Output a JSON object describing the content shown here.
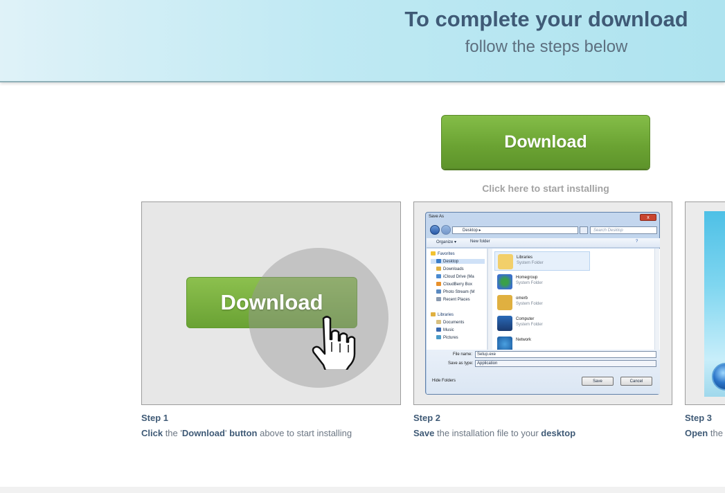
{
  "header": {
    "title": "To complete your download",
    "subtitle": "follow the steps below"
  },
  "download": {
    "button_label": "Download",
    "hint": "Click here to start installing"
  },
  "steps": [
    {
      "title": "Step 1",
      "illustration_label": "Download",
      "text": {
        "b1": "Click",
        "t1": " the '",
        "b2": "Download",
        "t2": "' ",
        "b3": "button",
        "t3": " above to start installing"
      }
    },
    {
      "title": "Step 2",
      "text": {
        "b1": "Save",
        "t1": " the installation file to your ",
        "b2": "desktop"
      }
    },
    {
      "title": "Step 3",
      "text": {
        "b1": "Open",
        "t1": " the"
      }
    }
  ],
  "dialog": {
    "title": "Save As",
    "close": "x",
    "address": "Desktop  ▸",
    "search_placeholder": "Search Desktop",
    "toolbar": {
      "organize": "Organize ▾",
      "new_folder": "New folder"
    },
    "tree": {
      "favorites": "Favorites",
      "favorites_items": [
        "Desktop",
        "Downloads",
        "iCloud Drive (Ma",
        "CloudBerry Box",
        "Photo Stream (M",
        "Recent Places"
      ],
      "libraries": "Libraries",
      "libraries_items": [
        "Documents",
        "Music",
        "Pictures"
      ]
    },
    "items": [
      {
        "name": "Libraries",
        "type": "System Folder"
      },
      {
        "name": "Homegroup",
        "type": "System Folder"
      },
      {
        "name": "omerb",
        "type": "System Folder"
      },
      {
        "name": "Computer",
        "type": "System Folder"
      },
      {
        "name": "Network",
        "type": ""
      }
    ],
    "file_name_label": "File name:",
    "file_name_value": "Setup.exe",
    "save_type_label": "Save as type:",
    "save_type_value": "Application",
    "hide_folders": "Hide Folders",
    "save_button": "Save",
    "cancel_button": "Cancel"
  },
  "colors": {
    "accent_green": "#6aa232",
    "title_blue": "#3f5a76",
    "header_bg": "#bfe9f3"
  }
}
